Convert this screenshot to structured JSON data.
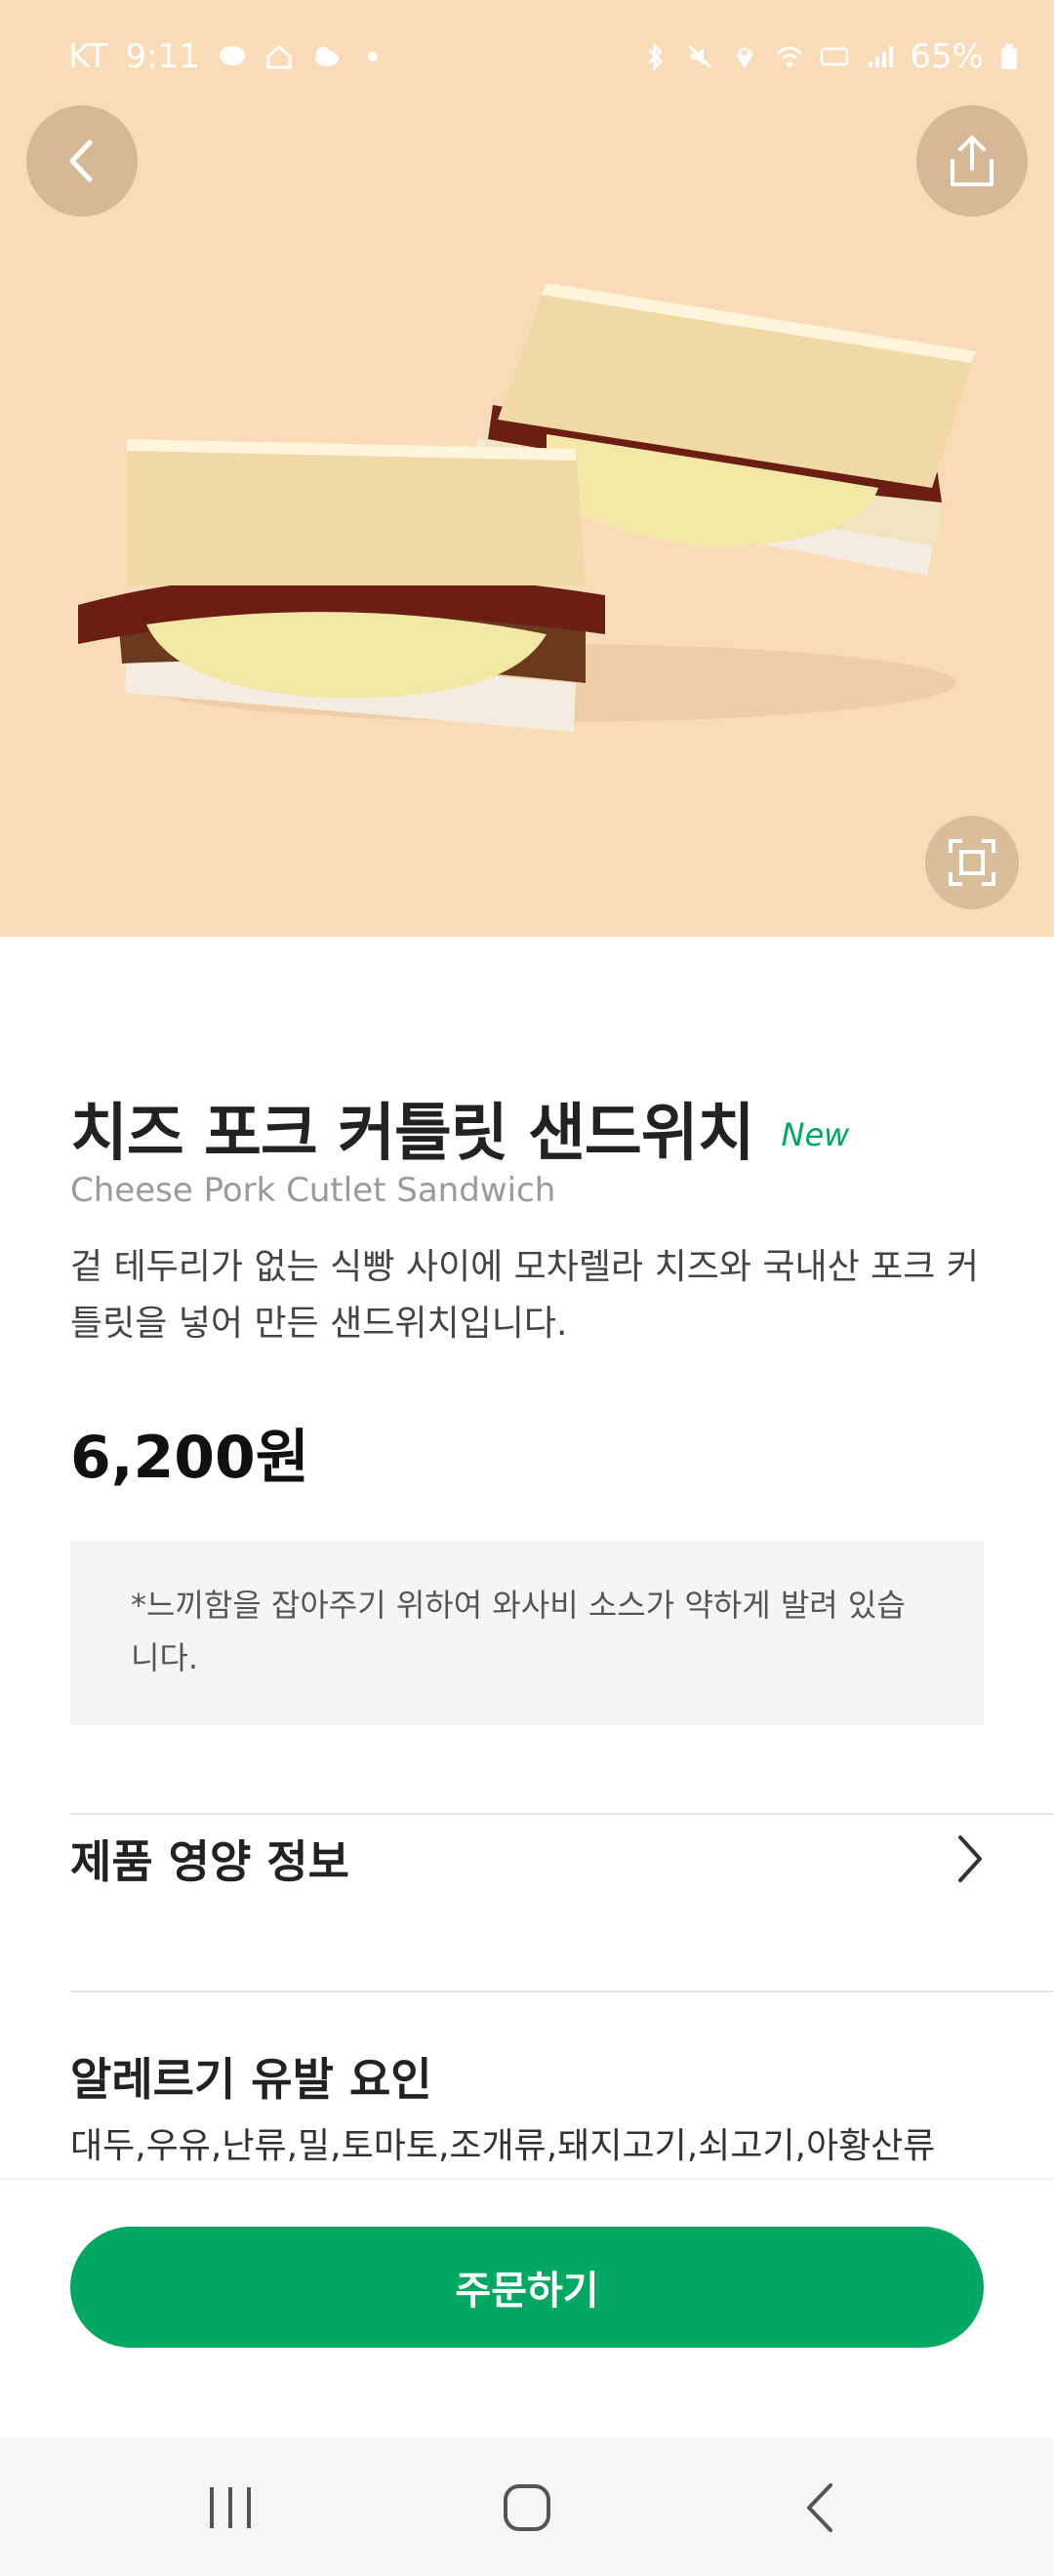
{
  "status_bar": {
    "carrier": "KT",
    "time": "9:11",
    "battery": "65%"
  },
  "header": {
    "back_icon": "chevron-left-icon",
    "share_icon": "share-icon",
    "zoom_icon": "expand-icon"
  },
  "product": {
    "title": "치즈 포크 커틀릿 샌드위치",
    "badge": "New",
    "english_name": "Cheese Pork Cutlet Sandwich",
    "description": "겉 테두리가 없는 식빵 사이에 모차렐라 치즈와 국내산 포크 커틀릿을 넣어 만든 샌드위치입니다.",
    "price": "6,200원",
    "notice": "*느끼함을 잡아주기 위하여 와사비 소스가 약하게 발려 있습니다."
  },
  "sections": {
    "nutrition_label": "제품 영양 정보",
    "allergy_label": "알레르기 유발 요인",
    "allergy_text": "대두,우유,난류,밀,토마토,조개류,돼지고기,쇠고기,아황산류"
  },
  "order": {
    "button_label": "주문하기"
  },
  "colors": {
    "accent": "#00a862",
    "hero_bg": "#f9dcb7"
  }
}
